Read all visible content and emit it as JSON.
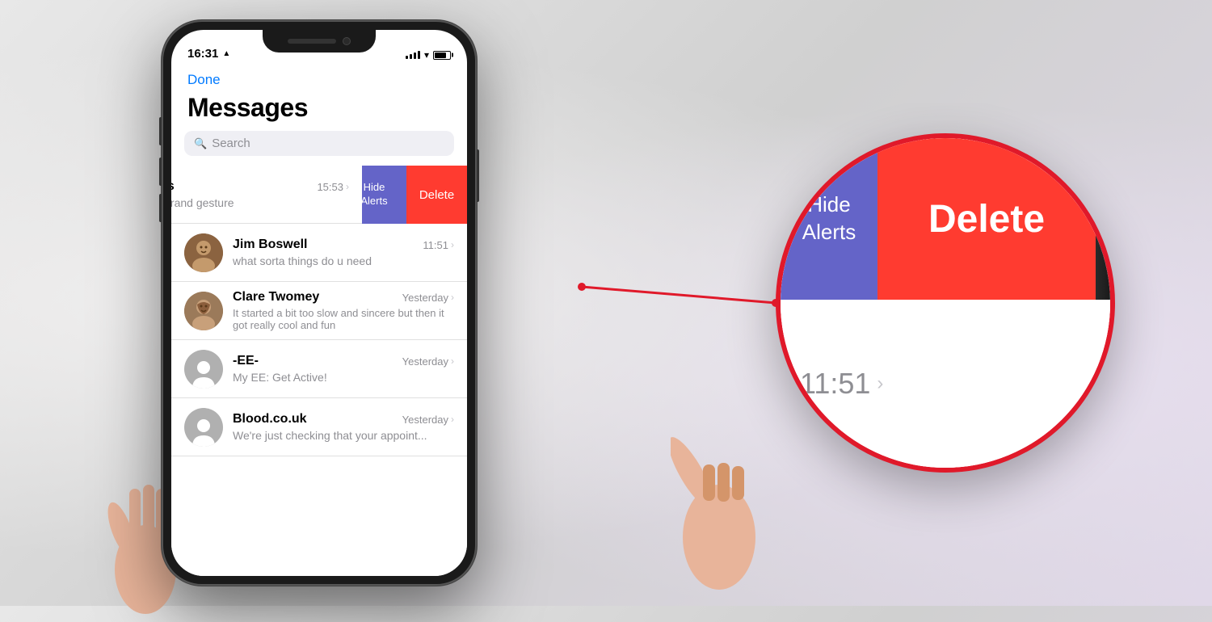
{
  "phone": {
    "status_time": "16:31",
    "nav": {
      "done_label": "Done"
    },
    "title": "Messages",
    "search_placeholder": "Search",
    "messages": [
      {
        "id": "hawkins",
        "name": "...wkins",
        "time": "15:53",
        "preview": "...dly a grand gesture",
        "avatar_type": "hawkins",
        "swiped": true
      },
      {
        "id": "boswell",
        "name": "Jim Boswell",
        "time": "11:51",
        "preview": "what sorta things do u need",
        "avatar_type": "boswell",
        "swiped": false
      },
      {
        "id": "twomey",
        "name": "Clare Twomey",
        "time": "Yesterday",
        "preview": "It started a bit too slow and sincere but then it got really cool and fun",
        "avatar_type": "twomey",
        "swiped": false
      },
      {
        "id": "ee",
        "name": "-EE-",
        "time": "Yesterday",
        "preview": "My EE: Get Active!",
        "avatar_type": "default",
        "swiped": false
      },
      {
        "id": "blood",
        "name": "Blood.co.uk",
        "time": "Yesterday",
        "preview": "We're just checking that your appoint...",
        "avatar_type": "default",
        "swiped": false
      }
    ],
    "swipe_actions": {
      "hide_alerts": "Hide\nAlerts",
      "delete": "Delete"
    }
  },
  "magnified": {
    "blue_text": "Hide\nAlerts",
    "delete_text": "Delete",
    "time": "11:51",
    "colors": {
      "blue": "#6464C8",
      "red": "#FF3B30",
      "circle_border": "#e0192a"
    }
  }
}
